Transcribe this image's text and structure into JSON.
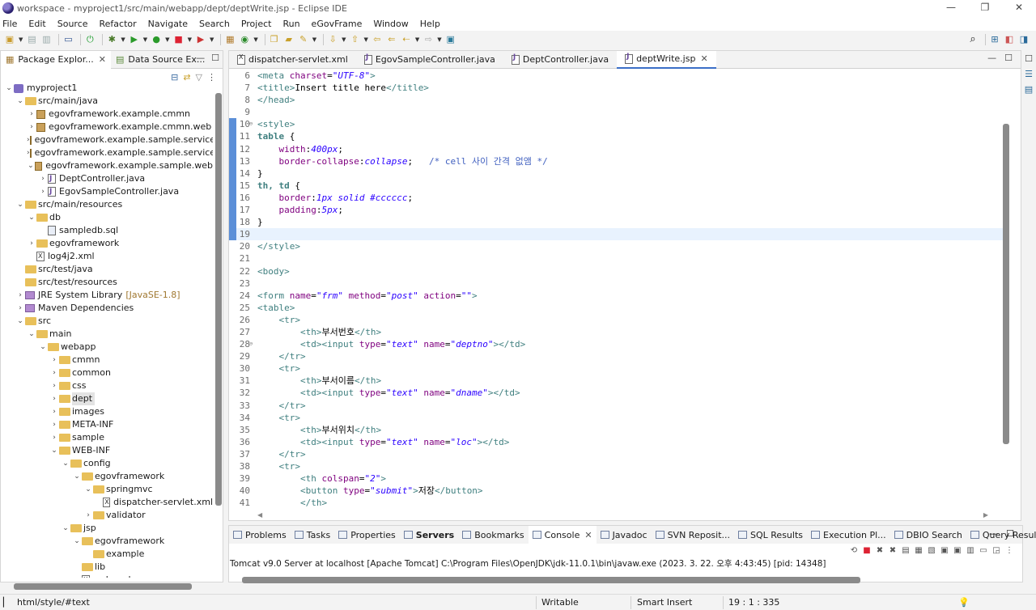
{
  "window": {
    "title": "workspace - myproject1/src/main/webapp/dept/deptWrite.jsp - Eclipse IDE",
    "controls": [
      "—",
      "❐",
      "✕"
    ]
  },
  "menu": [
    "File",
    "Edit",
    "Source",
    "Refactor",
    "Navigate",
    "Search",
    "Project",
    "Run",
    "eGovFrame",
    "Window",
    "Help"
  ],
  "left_panel": {
    "tabs": [
      {
        "label": "Package Explor...",
        "active": true
      },
      {
        "label": "Data Source Ex...",
        "active": false
      }
    ],
    "tree": [
      {
        "label": "myproject1",
        "depth": 0,
        "twisty": "open",
        "icon": "proj"
      },
      {
        "label": "src/main/java",
        "depth": 1,
        "twisty": "open",
        "icon": "folder"
      },
      {
        "label": "egovframework.example.cmmn",
        "depth": 2,
        "twisty": "closed",
        "icon": "pkg"
      },
      {
        "label": "egovframework.example.cmmn.web",
        "depth": 2,
        "twisty": "closed",
        "icon": "pkg"
      },
      {
        "label": "egovframework.example.sample.service",
        "depth": 2,
        "twisty": "closed",
        "icon": "pkg"
      },
      {
        "label": "egovframework.example.sample.service.im",
        "depth": 2,
        "twisty": "closed",
        "icon": "pkg"
      },
      {
        "label": "egovframework.example.sample.web",
        "depth": 2,
        "twisty": "open",
        "icon": "pkg"
      },
      {
        "label": "DeptController.java",
        "depth": 3,
        "twisty": "closed",
        "icon": "java"
      },
      {
        "label": "EgovSampleController.java",
        "depth": 3,
        "twisty": "closed",
        "icon": "java"
      },
      {
        "label": "src/main/resources",
        "depth": 1,
        "twisty": "open",
        "icon": "folder"
      },
      {
        "label": "db",
        "depth": 2,
        "twisty": "open",
        "icon": "folder"
      },
      {
        "label": "sampledb.sql",
        "depth": 3,
        "twisty": "none",
        "icon": "sql"
      },
      {
        "label": "egovframework",
        "depth": 2,
        "twisty": "closed",
        "icon": "folder"
      },
      {
        "label": "log4j2.xml",
        "depth": 2,
        "twisty": "none",
        "icon": "xml"
      },
      {
        "label": "src/test/java",
        "depth": 1,
        "twisty": "none",
        "icon": "folder"
      },
      {
        "label": "src/test/resources",
        "depth": 1,
        "twisty": "none",
        "icon": "folder"
      },
      {
        "label": "JRE System Library",
        "decoration": "[JavaSE-1.8]",
        "depth": 1,
        "twisty": "closed",
        "icon": "lib"
      },
      {
        "label": "Maven Dependencies",
        "depth": 1,
        "twisty": "closed",
        "icon": "lib"
      },
      {
        "label": "src",
        "depth": 1,
        "twisty": "open",
        "icon": "folder"
      },
      {
        "label": "main",
        "depth": 2,
        "twisty": "open",
        "icon": "folder"
      },
      {
        "label": "webapp",
        "depth": 3,
        "twisty": "open",
        "icon": "folder"
      },
      {
        "label": "cmmn",
        "depth": 4,
        "twisty": "closed",
        "icon": "folder"
      },
      {
        "label": "common",
        "depth": 4,
        "twisty": "closed",
        "icon": "folder"
      },
      {
        "label": "css",
        "depth": 4,
        "twisty": "closed",
        "icon": "folder"
      },
      {
        "label": "dept",
        "depth": 4,
        "twisty": "closed",
        "icon": "folder",
        "selected": true
      },
      {
        "label": "images",
        "depth": 4,
        "twisty": "closed",
        "icon": "folder"
      },
      {
        "label": "META-INF",
        "depth": 4,
        "twisty": "closed",
        "icon": "folder"
      },
      {
        "label": "sample",
        "depth": 4,
        "twisty": "closed",
        "icon": "folder"
      },
      {
        "label": "WEB-INF",
        "depth": 4,
        "twisty": "open",
        "icon": "folder"
      },
      {
        "label": "config",
        "depth": 5,
        "twisty": "open",
        "icon": "folder"
      },
      {
        "label": "egovframework",
        "depth": 6,
        "twisty": "open",
        "icon": "folder"
      },
      {
        "label": "springmvc",
        "depth": 7,
        "twisty": "open",
        "icon": "folder"
      },
      {
        "label": "dispatcher-servlet.xml",
        "depth": 8,
        "twisty": "none",
        "icon": "xml"
      },
      {
        "label": "validator",
        "depth": 7,
        "twisty": "closed",
        "icon": "folder"
      },
      {
        "label": "jsp",
        "depth": 5,
        "twisty": "open",
        "icon": "folder"
      },
      {
        "label": "egovframework",
        "depth": 6,
        "twisty": "open",
        "icon": "folder"
      },
      {
        "label": "example",
        "depth": 7,
        "twisty": "none",
        "icon": "folder"
      },
      {
        "label": "lib",
        "depth": 6,
        "twisty": "none",
        "icon": "folder"
      },
      {
        "label": "web.xml",
        "depth": 6,
        "twisty": "none",
        "icon": "xml"
      }
    ]
  },
  "editor": {
    "tabs": [
      {
        "label": "dispatcher-servlet.xml",
        "icon": "xml",
        "active": false
      },
      {
        "label": "EgovSampleController.java",
        "icon": "java",
        "active": false
      },
      {
        "label": "DeptController.java",
        "icon": "java",
        "active": false
      },
      {
        "label": "deptWrite.jsp",
        "icon": "jsp",
        "active": true
      }
    ],
    "lines": [
      {
        "n": "6",
        "seg": [
          [
            "t-tag",
            "<meta "
          ],
          [
            "t-attr",
            "charset"
          ],
          [
            "t-txt",
            "="
          ],
          [
            "t-str",
            "\"UTF-8\""
          ],
          [
            "t-tag",
            ">"
          ]
        ]
      },
      {
        "n": "7",
        "seg": [
          [
            "t-tag",
            "<title>"
          ],
          [
            "t-txt",
            "Insert title here"
          ],
          [
            "t-tag",
            "</title>"
          ]
        ]
      },
      {
        "n": "8",
        "seg": [
          [
            "t-tag",
            "</head>"
          ]
        ]
      },
      {
        "n": "9",
        "seg": []
      },
      {
        "n": "10",
        "fold": true,
        "mark": true,
        "seg": [
          [
            "t-tag",
            "<style>"
          ]
        ]
      },
      {
        "n": "11",
        "mark": true,
        "seg": [
          [
            "t-sel",
            "table "
          ],
          [
            "t-txt",
            "{"
          ]
        ]
      },
      {
        "n": "12",
        "mark": true,
        "seg": [
          [
            "t-txt",
            "    "
          ],
          [
            "t-prop",
            "width"
          ],
          [
            "t-txt",
            ":"
          ],
          [
            "t-val",
            "400px"
          ],
          [
            "t-txt",
            ";"
          ]
        ]
      },
      {
        "n": "13",
        "mark": true,
        "seg": [
          [
            "t-txt",
            "    "
          ],
          [
            "t-prop",
            "border-collapse"
          ],
          [
            "t-txt",
            ":"
          ],
          [
            "t-val",
            "collapse"
          ],
          [
            "t-txt",
            ";   "
          ],
          [
            "t-cmt",
            "/* cell 사이 간격 없앰 */"
          ]
        ]
      },
      {
        "n": "14",
        "mark": true,
        "seg": [
          [
            "t-txt",
            "}"
          ]
        ]
      },
      {
        "n": "15",
        "mark": true,
        "seg": [
          [
            "t-sel",
            "th, td "
          ],
          [
            "t-txt",
            "{"
          ]
        ]
      },
      {
        "n": "16",
        "mark": true,
        "seg": [
          [
            "t-txt",
            "    "
          ],
          [
            "t-prop",
            "border"
          ],
          [
            "t-txt",
            ":"
          ],
          [
            "t-val",
            "1px solid #cccccc"
          ],
          [
            "t-txt",
            ";"
          ]
        ]
      },
      {
        "n": "17",
        "mark": true,
        "seg": [
          [
            "t-txt",
            "    "
          ],
          [
            "t-prop",
            "padding"
          ],
          [
            "t-txt",
            ":"
          ],
          [
            "t-val",
            "5px"
          ],
          [
            "t-txt",
            ";"
          ]
        ]
      },
      {
        "n": "18",
        "mark": true,
        "seg": [
          [
            "t-txt",
            "}"
          ]
        ]
      },
      {
        "n": "19",
        "mark": true,
        "current": true,
        "seg": []
      },
      {
        "n": "20",
        "seg": [
          [
            "t-tag",
            "</style>"
          ]
        ]
      },
      {
        "n": "21",
        "seg": []
      },
      {
        "n": "22",
        "seg": [
          [
            "t-tag",
            "<body>"
          ]
        ]
      },
      {
        "n": "23",
        "seg": []
      },
      {
        "n": "24",
        "seg": [
          [
            "t-tag",
            "<form "
          ],
          [
            "t-attr",
            "name"
          ],
          [
            "t-txt",
            "="
          ],
          [
            "t-str",
            "\"frm\""
          ],
          [
            "t-txt",
            " "
          ],
          [
            "t-attr",
            "method"
          ],
          [
            "t-txt",
            "="
          ],
          [
            "t-str",
            "\"post\""
          ],
          [
            "t-txt",
            " "
          ],
          [
            "t-attr",
            "action"
          ],
          [
            "t-txt",
            "="
          ],
          [
            "t-str",
            "\"\""
          ],
          [
            "t-tag",
            ">"
          ]
        ]
      },
      {
        "n": "25",
        "seg": [
          [
            "t-tag",
            "<table>"
          ]
        ]
      },
      {
        "n": "26",
        "seg": [
          [
            "t-txt",
            "    "
          ],
          [
            "t-tag",
            "<tr>"
          ]
        ]
      },
      {
        "n": "27",
        "seg": [
          [
            "t-txt",
            "        "
          ],
          [
            "t-tag",
            "<th>"
          ],
          [
            "t-txt",
            "부서번호"
          ],
          [
            "t-tag",
            "</th>"
          ]
        ]
      },
      {
        "n": "28",
        "fold": true,
        "seg": [
          [
            "t-txt",
            "        "
          ],
          [
            "t-tag",
            "<td><input "
          ],
          [
            "t-attr",
            "type"
          ],
          [
            "t-txt",
            "="
          ],
          [
            "t-str",
            "\"text\""
          ],
          [
            "t-txt",
            " "
          ],
          [
            "t-attr",
            "name"
          ],
          [
            "t-txt",
            "="
          ],
          [
            "t-str",
            "\"deptno\""
          ],
          [
            "t-tag",
            "></td>"
          ]
        ]
      },
      {
        "n": "29",
        "seg": [
          [
            "t-txt",
            "    "
          ],
          [
            "t-tag",
            "</tr>"
          ]
        ]
      },
      {
        "n": "30",
        "seg": [
          [
            "t-txt",
            "    "
          ],
          [
            "t-tag",
            "<tr>"
          ]
        ]
      },
      {
        "n": "31",
        "seg": [
          [
            "t-txt",
            "        "
          ],
          [
            "t-tag",
            "<th>"
          ],
          [
            "t-txt",
            "부서이름"
          ],
          [
            "t-tag",
            "</th>"
          ]
        ]
      },
      {
        "n": "32",
        "seg": [
          [
            "t-txt",
            "        "
          ],
          [
            "t-tag",
            "<td><input "
          ],
          [
            "t-attr",
            "type"
          ],
          [
            "t-txt",
            "="
          ],
          [
            "t-str",
            "\"text\""
          ],
          [
            "t-txt",
            " "
          ],
          [
            "t-attr",
            "name"
          ],
          [
            "t-txt",
            "="
          ],
          [
            "t-str",
            "\"dname\""
          ],
          [
            "t-tag",
            "></td>"
          ]
        ]
      },
      {
        "n": "33",
        "seg": [
          [
            "t-txt",
            "    "
          ],
          [
            "t-tag",
            "</tr>"
          ]
        ]
      },
      {
        "n": "34",
        "seg": [
          [
            "t-txt",
            "    "
          ],
          [
            "t-tag",
            "<tr>"
          ]
        ]
      },
      {
        "n": "35",
        "seg": [
          [
            "t-txt",
            "        "
          ],
          [
            "t-tag",
            "<th>"
          ],
          [
            "t-txt",
            "부서위치"
          ],
          [
            "t-tag",
            "</th>"
          ]
        ]
      },
      {
        "n": "36",
        "seg": [
          [
            "t-txt",
            "        "
          ],
          [
            "t-tag",
            "<td><input "
          ],
          [
            "t-attr",
            "type"
          ],
          [
            "t-txt",
            "="
          ],
          [
            "t-str",
            "\"text\""
          ],
          [
            "t-txt",
            " "
          ],
          [
            "t-attr",
            "name"
          ],
          [
            "t-txt",
            "="
          ],
          [
            "t-str",
            "\"loc\""
          ],
          [
            "t-tag",
            "></td>"
          ]
        ]
      },
      {
        "n": "37",
        "seg": [
          [
            "t-txt",
            "    "
          ],
          [
            "t-tag",
            "</tr>"
          ]
        ]
      },
      {
        "n": "38",
        "seg": [
          [
            "t-txt",
            "    "
          ],
          [
            "t-tag",
            "<tr>"
          ]
        ]
      },
      {
        "n": "39",
        "seg": [
          [
            "t-txt",
            "        "
          ],
          [
            "t-tag",
            "<th "
          ],
          [
            "t-attr",
            "colspan"
          ],
          [
            "t-txt",
            "="
          ],
          [
            "t-str",
            "\"2\""
          ],
          [
            "t-tag",
            ">"
          ]
        ]
      },
      {
        "n": "40",
        "seg": [
          [
            "t-txt",
            "        "
          ],
          [
            "t-tag",
            "<button "
          ],
          [
            "t-attr",
            "type"
          ],
          [
            "t-txt",
            "="
          ],
          [
            "t-str",
            "\"submit\""
          ],
          [
            "t-tag",
            ">"
          ],
          [
            "t-txt",
            "저장"
          ],
          [
            "t-tag",
            "</button>"
          ]
        ]
      },
      {
        "n": "41",
        "seg": [
          [
            "t-txt",
            "        "
          ],
          [
            "t-tag",
            "</th>"
          ]
        ]
      }
    ]
  },
  "console": {
    "tabs": [
      {
        "label": "Problems",
        "active": false
      },
      {
        "label": "Tasks",
        "active": false
      },
      {
        "label": "Properties",
        "active": false
      },
      {
        "label": "Servers",
        "active": false,
        "bold": true
      },
      {
        "label": "Bookmarks",
        "active": false
      },
      {
        "label": "Console",
        "active": true,
        "closable": true
      },
      {
        "label": "Javadoc",
        "active": false
      },
      {
        "label": "SVN Reposit...",
        "active": false
      },
      {
        "label": "SQL Results",
        "active": false
      },
      {
        "label": "Execution Pl...",
        "active": false
      },
      {
        "label": "DBIO Search",
        "active": false
      },
      {
        "label": "Query Result",
        "active": false
      }
    ],
    "text": "Tomcat v9.0 Server at localhost [Apache Tomcat] C:\\Program Files\\OpenJDK\\jdk-11.0.1\\bin\\javaw.exe  (2023. 3. 22. 오후 4:43:45) [pid: 14348]"
  },
  "status": {
    "path": "html/style/#text",
    "mode": "Writable",
    "insert": "Smart Insert",
    "position": "19 : 1 : 335"
  }
}
